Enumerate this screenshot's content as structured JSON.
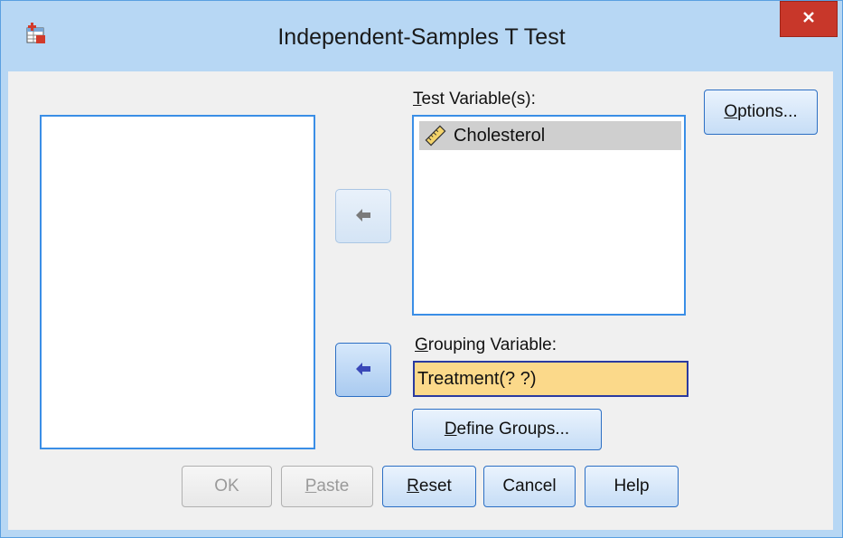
{
  "window": {
    "title": "Independent-Samples T Test",
    "app_icon": "spss-table-icon",
    "close_icon": "close-icon"
  },
  "source_variables": {
    "items": []
  },
  "test_variables": {
    "label_prefix": "",
    "label_mnemonic": "T",
    "label_rest": "est Variable(s):",
    "items": [
      {
        "label": "Cholesterol",
        "icon": "scale-ruler-icon",
        "selected": true
      }
    ]
  },
  "move_buttons": {
    "test_arrow_icon": "arrow-move-icon",
    "grouping_arrow_icon": "arrow-move-icon"
  },
  "grouping_variable": {
    "label_mnemonic": "G",
    "label_rest": "rouping Variable:",
    "value": "Treatment(? ?)"
  },
  "buttons": {
    "options": {
      "mnemonic": "O",
      "rest": "ptions..."
    },
    "define_groups": {
      "mnemonic": "D",
      "rest": "efine Groups..."
    },
    "ok": {
      "label": "OK",
      "enabled": false
    },
    "paste": {
      "mnemonic": "P",
      "rest": "aste",
      "enabled": false
    },
    "reset": {
      "mnemonic": "R",
      "rest": "eset"
    },
    "cancel": {
      "label": "Cancel"
    },
    "help": {
      "label": "Help"
    }
  },
  "colors": {
    "title_bar": "#b7d7f4",
    "close_button": "#c8372a",
    "focus_border": "#3a8ee6",
    "grouping_field_bg": "#fbd98a",
    "selected_item_bg": "#cfcfcf"
  }
}
